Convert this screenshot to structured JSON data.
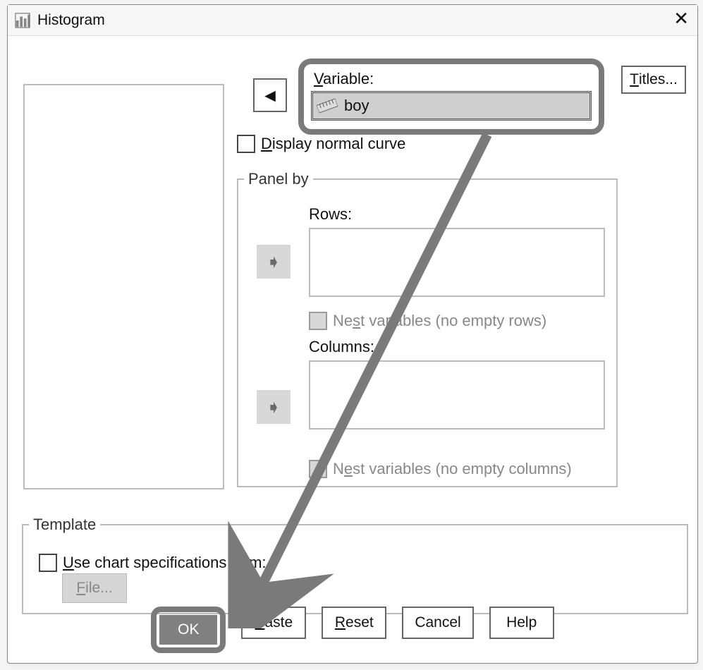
{
  "titlebar": {
    "title": "Histogram"
  },
  "variable": {
    "label_prefix": "V",
    "label_rest": "ariable:",
    "value": "boy"
  },
  "titles_button": {
    "u": "T",
    "rest": "itles..."
  },
  "display_normal": {
    "u": "D",
    "rest": "isplay normal curve"
  },
  "panel": {
    "legend": "Panel by",
    "rows_label_pre": "Ro",
    "rows_label_u": "w",
    "rows_label_post": "s:",
    "nest_rows_pre": "Ne",
    "nest_rows_u": "s",
    "nest_rows_post": "t variables (no empty rows)",
    "cols_label_pre": "Colu",
    "cols_label_u": "m",
    "cols_label_post": "ns:",
    "nest_cols_pre": "N",
    "nest_cols_u": "e",
    "nest_cols_post": "st variables (no empty columns)"
  },
  "template": {
    "legend": "Template",
    "use_u": "U",
    "use_rest": "se chart specifications from:",
    "file_u": "F",
    "file_rest": "ile..."
  },
  "buttons": {
    "ok": "OK",
    "paste_u": "P",
    "paste_rest": "aste",
    "reset_u": "R",
    "reset_rest": "eset",
    "cancel": "Cancel",
    "help": "Help"
  }
}
